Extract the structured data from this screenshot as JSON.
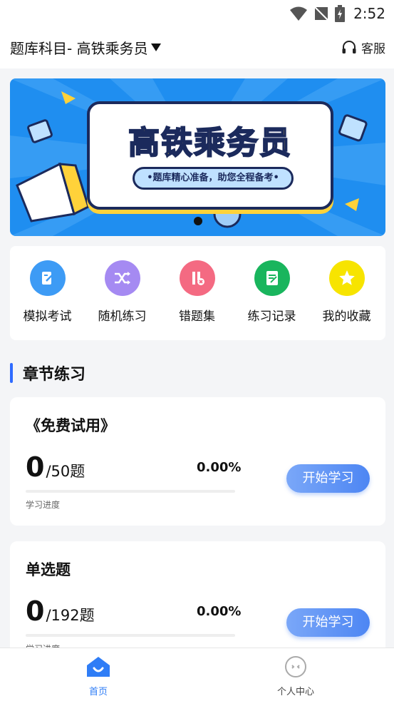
{
  "status_bar": {
    "time": "2:52"
  },
  "header": {
    "subject_title": "题库科目- 高铁乘务员",
    "service_label": "客服"
  },
  "banner": {
    "title": "高铁乘务员",
    "subtitle": "•题库精心准备，助您全程备考•"
  },
  "menu": {
    "items": [
      {
        "label": "模拟考试",
        "icon": "exam-icon",
        "color": "#3d9bf5"
      },
      {
        "label": "随机练习",
        "icon": "shuffle-icon",
        "color": "#a58af2"
      },
      {
        "label": "错题集",
        "icon": "wrong-questions-icon",
        "color": "#f46a82"
      },
      {
        "label": "练习记录",
        "icon": "record-icon",
        "color": "#19b55d"
      },
      {
        "label": "我的收藏",
        "icon": "star-icon",
        "color": "#f7e400"
      }
    ]
  },
  "section": {
    "title": "章节练习"
  },
  "chapters": [
    {
      "name": "《免费试用》",
      "done": "0",
      "total": "/50题",
      "percent": "0.00%",
      "progress": 0,
      "progress_label": "学习进度",
      "button": "开始学习"
    },
    {
      "name": "单选题",
      "done": "0",
      "total": "/192题",
      "percent": "0.00%",
      "progress": 0,
      "progress_label": "学习进度",
      "button": "开始学习"
    }
  ],
  "bottom_nav": {
    "home_label": "首页",
    "profile_label": "个人中心",
    "active_color": "#2f7df6"
  }
}
